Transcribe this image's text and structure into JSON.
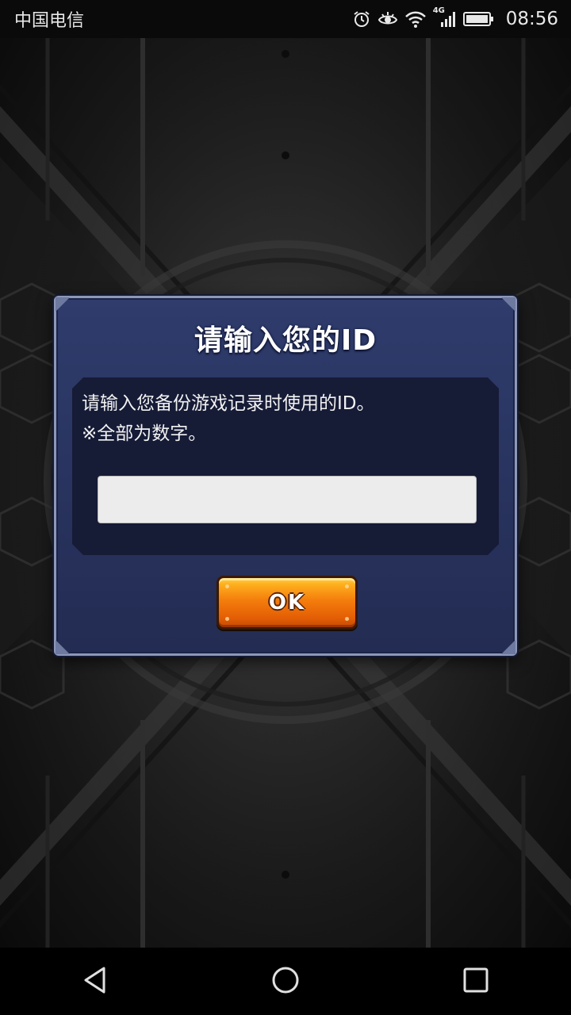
{
  "status_bar": {
    "carrier": "中国电信",
    "network_type": "4G",
    "time": "08:56",
    "icons": [
      "alarm-icon",
      "eye-comfort-icon",
      "wifi-icon",
      "cellular-signal-icon",
      "battery-icon"
    ]
  },
  "dialog": {
    "title": "请输入您的ID",
    "description_line1": "请输入您备份游戏记录时使用的ID。",
    "description_line2": "※全部为数字。",
    "id_input": {
      "value": "",
      "placeholder": ""
    },
    "ok_label": "OK"
  },
  "nav_bar": {
    "icons": [
      "back-icon",
      "home-icon",
      "recents-icon"
    ]
  },
  "colors": {
    "dialog_background": "#2b3764",
    "dialog_inner_panel": "#161b36",
    "ok_button": "#f47d0c",
    "game_background": "#262626"
  }
}
